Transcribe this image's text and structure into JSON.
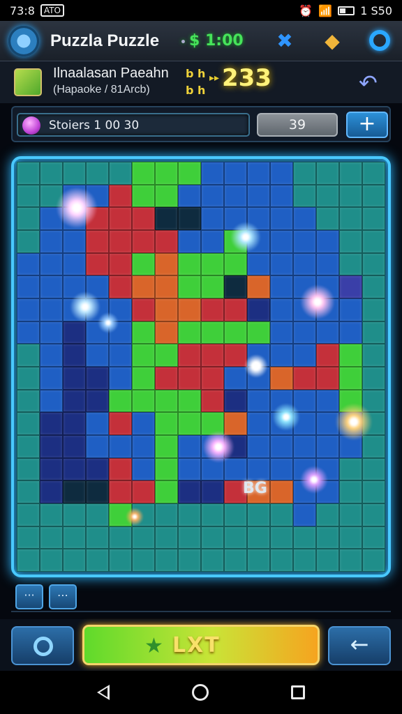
{
  "status": {
    "time": "73:8",
    "badge": "ATO",
    "battery_text": "1 S50"
  },
  "header": {
    "title": "Puzzla Puzzle",
    "coins": "$ 1:00"
  },
  "level": {
    "name": "Ilnaalasan Paeahn",
    "subtitle": "(Hapaoke / 81Arcb)",
    "tag_1": "b h",
    "tag_2": "b h",
    "score": "233"
  },
  "progress": {
    "text": "Stoiers 1 00 30",
    "count": "39",
    "plus_label": "+"
  },
  "board": {
    "center_label": "BG",
    "colors": {
      "teal": "#1f8e8a",
      "blue": "#1f5fc4",
      "green": "#3fcf3a",
      "red": "#c4303a",
      "orange": "#d9652a",
      "navy": "#1c2f82",
      "dark": "#0e2b3f",
      "purple": "#3a3fa8"
    }
  },
  "tray": {
    "menu_label": "···",
    "chat_label": "⋯"
  },
  "controls": {
    "next_label": "LXT",
    "back_label": "←"
  }
}
